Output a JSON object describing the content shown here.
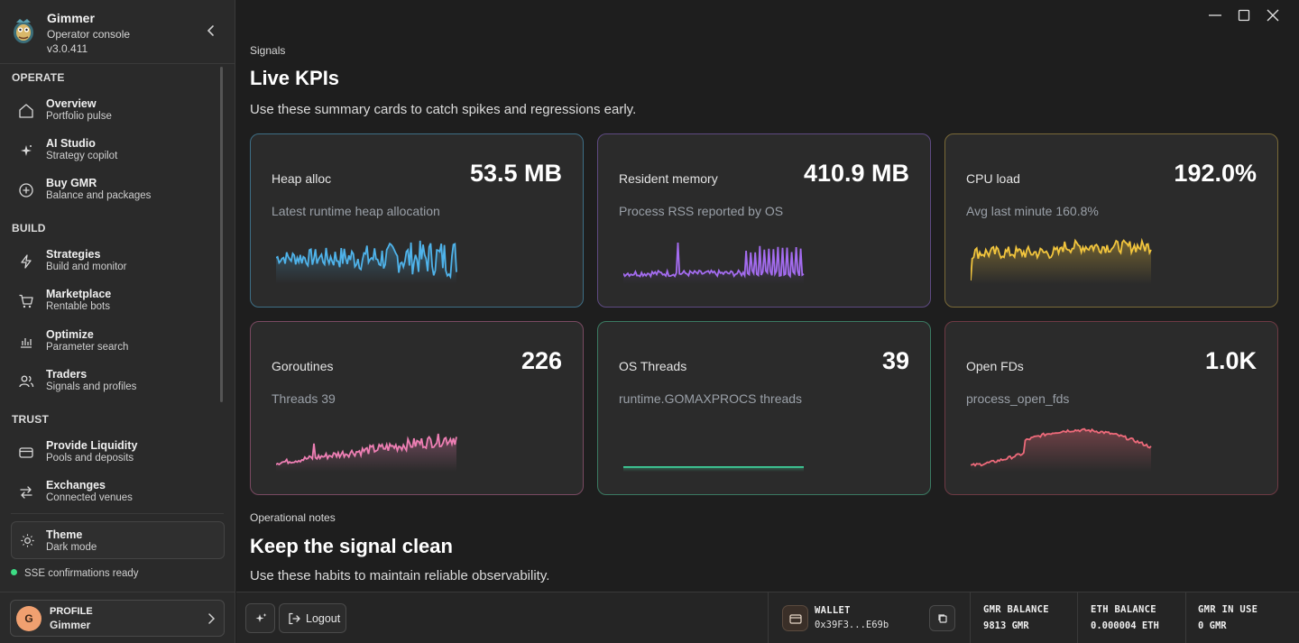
{
  "app": {
    "name": "Gimmer",
    "subtitle": "Operator console",
    "version": "v3.0.411"
  },
  "sidebar": {
    "sections": [
      {
        "label": "OPERATE"
      },
      {
        "label": "BUILD"
      },
      {
        "label": "TRUST"
      }
    ],
    "items": [
      {
        "title": "Overview",
        "subtitle": "Portfolio pulse",
        "icon": "home-icon"
      },
      {
        "title": "AI Studio",
        "subtitle": "Strategy copilot",
        "icon": "sparkle-icon"
      },
      {
        "title": "Buy GMR",
        "subtitle": "Balance and packages",
        "icon": "plus-circle-icon"
      },
      {
        "title": "Strategies",
        "subtitle": "Build and monitor",
        "icon": "bolt-icon"
      },
      {
        "title": "Marketplace",
        "subtitle": "Rentable bots",
        "icon": "cart-icon"
      },
      {
        "title": "Optimize",
        "subtitle": "Parameter search",
        "icon": "bar-chart-icon"
      },
      {
        "title": "Traders",
        "subtitle": "Signals and profiles",
        "icon": "users-icon"
      },
      {
        "title": "Provide Liquidity",
        "subtitle": "Pools and deposits",
        "icon": "wallet-icon"
      },
      {
        "title": "Exchanges",
        "subtitle": "Connected venues",
        "icon": "swap-icon"
      }
    ],
    "theme": {
      "title": "Theme",
      "subtitle": "Dark mode"
    },
    "status": "SSE confirmations ready",
    "profile": {
      "label": "PROFILE",
      "name": "Gimmer",
      "initial": "G"
    }
  },
  "main": {
    "signals": {
      "eyebrow": "Signals",
      "title": "Live KPIs",
      "lead": "Use these summary cards to catch spikes and regressions early."
    },
    "cards": [
      {
        "label": "Heap alloc",
        "value": "53.5 MB",
        "sub": "Latest runtime heap allocation",
        "color": "#4fb3ea"
      },
      {
        "label": "Resident memory",
        "value": "410.9 MB",
        "sub": "Process RSS reported by OS",
        "color": "#a46cf0"
      },
      {
        "label": "CPU load",
        "value": "192.0%",
        "sub": "Avg last minute 160.8%",
        "color": "#f2c53d"
      },
      {
        "label": "Goroutines",
        "value": "226",
        "sub": "Threads 39",
        "color": "#ee7fb4"
      },
      {
        "label": "OS Threads",
        "value": "39",
        "sub": "runtime.GOMAXPROCS threads",
        "color": "#3ecf9a"
      },
      {
        "label": "Open FDs",
        "value": "1.0K",
        "sub": "process_open_fds",
        "color": "#ee6a7a"
      }
    ],
    "notes": {
      "eyebrow": "Operational notes",
      "title": "Keep the signal clean",
      "lead": "Use these habits to maintain reliable observability."
    }
  },
  "bottombar": {
    "logout_label": "Logout",
    "wallet": {
      "label": "WALLET",
      "address": "0x39F3...E69b"
    },
    "gmr_balance": {
      "label": "GMR BALANCE",
      "value": "9813 GMR"
    },
    "eth_balance": {
      "label": "ETH BALANCE",
      "value": "0.000004 ETH"
    },
    "gmr_in_use": {
      "label": "GMR IN USE",
      "value": "0 GMR"
    }
  }
}
